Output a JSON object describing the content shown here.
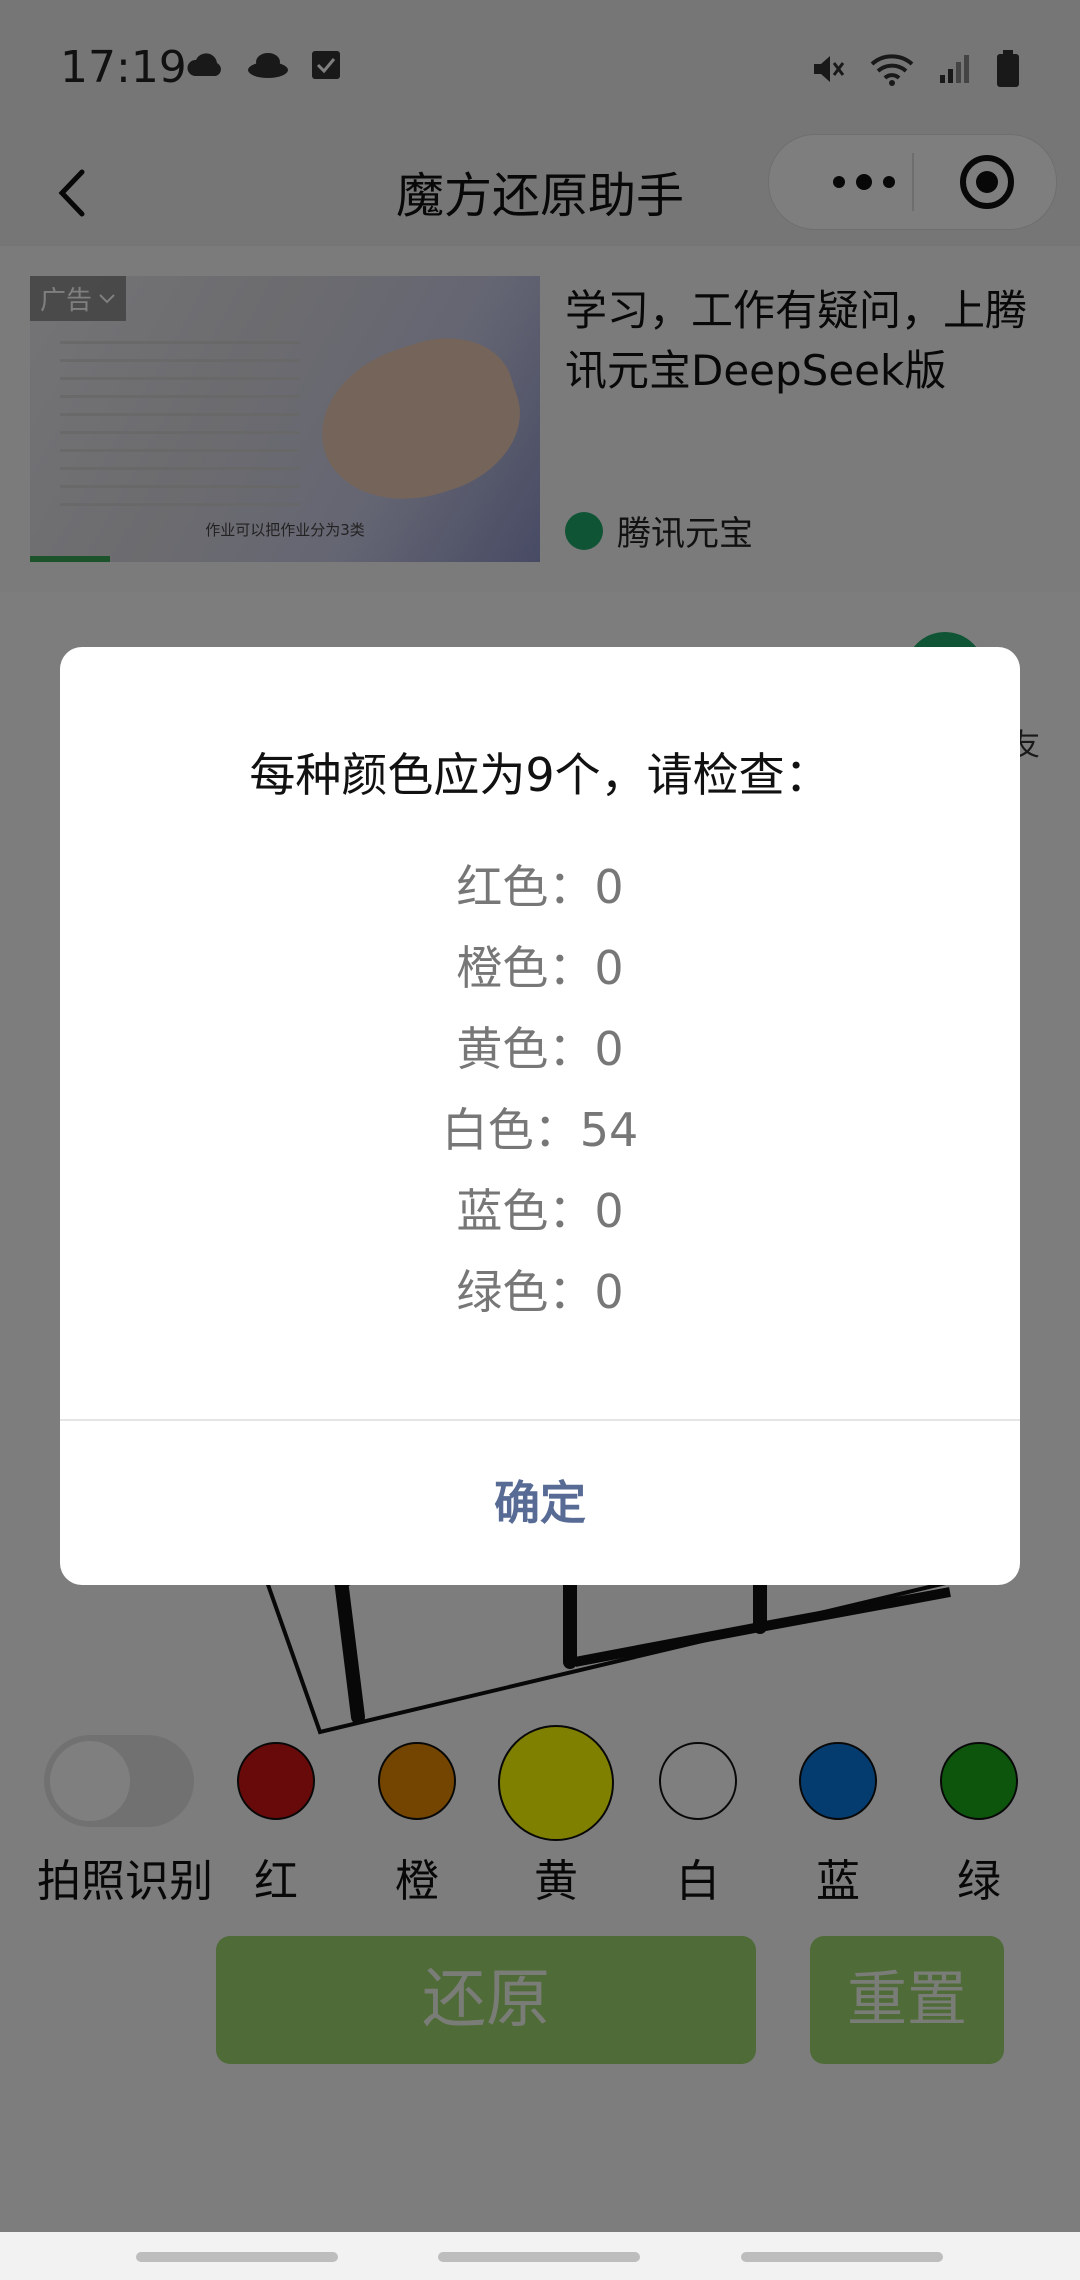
{
  "status_bar": {
    "time": "17:19",
    "left_icons": [
      "cloud-icon",
      "hat-icon",
      "checkbox-icon"
    ],
    "right_icons": [
      "mute-icon",
      "wifi-icon",
      "signal-icon",
      "battery-icon"
    ]
  },
  "nav": {
    "title": "魔方还原助手",
    "back_icon": "chevron-left-icon",
    "more_icon": "more-dots-icon",
    "target_icon": "target-icon"
  },
  "ad": {
    "badge": "广告",
    "headline": "学习，工作有疑问，上腾讯元宝DeepSeek版",
    "brand": "腾讯元宝",
    "image_caption": "作业可以把作业分为3类"
  },
  "side": {
    "text": "友"
  },
  "toggle": {
    "label": "拍照识别",
    "on": false
  },
  "colors": [
    {
      "label": "红",
      "hex": "#d11414"
    },
    {
      "label": "橙",
      "hex": "#e88a00"
    },
    {
      "label": "黄",
      "hex": "#ffff00"
    },
    {
      "label": "白",
      "hex": "#ffffff"
    },
    {
      "label": "蓝",
      "hex": "#0a78e0"
    },
    {
      "label": "绿",
      "hex": "#1aa81a"
    }
  ],
  "buttons": {
    "restore": "还原",
    "reset": "重置"
  },
  "modal": {
    "title": "每种颜色应为9个，请检查：",
    "rows": [
      "红色：0",
      "橙色：0",
      "黄色：0",
      "白色：54",
      "蓝色：0",
      "绿色：0"
    ],
    "confirm": "确定"
  }
}
